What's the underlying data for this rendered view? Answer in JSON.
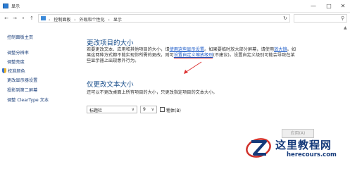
{
  "window": {
    "title": "显示"
  },
  "addressbar": {
    "breadcrumbs": [
      "控制面板",
      "外观和个性化",
      "显示"
    ]
  },
  "sidebar": {
    "items": [
      {
        "label": "控制面板主页"
      },
      {
        "label": "调整分辨率"
      },
      {
        "label": "调整亮度"
      },
      {
        "label": "校准颜色"
      },
      {
        "label": "更改显示器设置"
      },
      {
        "label": "投影到第二屏幕"
      },
      {
        "label": "调整 ClearType 文本"
      }
    ]
  },
  "main": {
    "section1": {
      "heading": "更改项目的大小",
      "p1_a": "若要更改文本、应用和其他项目的大小，请",
      "p1_link1": "使用这些显示设置",
      "p1_b": "。如果要临时放大部分屏幕，请使用",
      "p1_link2": "放大镜",
      "p1_c": "。如",
      "p2_a": "果这两种方式都不能实现你所需的更改，则可",
      "p2_link": "设置自定义缩放级别",
      "p2_b": "(不建议)。设置自定义级别可能会导致在某",
      "p3": "些显示器上出现意外行为。"
    },
    "section2": {
      "heading": "仅更改文本大小",
      "desc": "还可以不更改桌面上所有项目的大小，只更改指定项目的文本大小。",
      "item_select": "标题栏",
      "size_select": "9",
      "bold_label": "粗体(B)",
      "bold_checked": false
    },
    "apply_label": "应用(A)"
  },
  "watermark": {
    "title": "这里教程网",
    "url": "herecours.com",
    "colors": {
      "primary": "#153a7a",
      "accent": "#d0302a"
    }
  }
}
